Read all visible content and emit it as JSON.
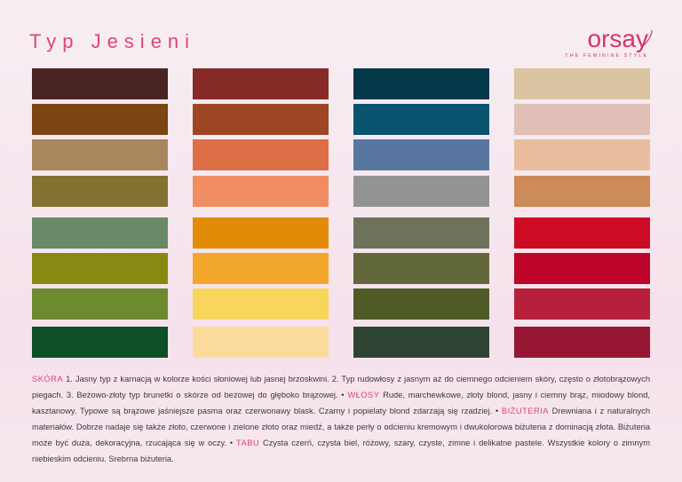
{
  "title": "Typ Jesieni",
  "brand": {
    "name": "orsay",
    "tagline": "THE FEMININE STYLE"
  },
  "palette": [
    {
      "column": 1,
      "colors": [
        "#4a2422",
        "#7a4512",
        "#a8875f",
        "#847232",
        "#688a66",
        "#878913",
        "#6e8a2f",
        "#0d4f27"
      ]
    },
    {
      "column": 2,
      "colors": [
        "#852a27",
        "#9e4623",
        "#dc6f45",
        "#f08d61",
        "#e28b07",
        "#f2a72c",
        "#f8d55b",
        "#fbdb9c"
      ]
    },
    {
      "column": 3,
      "colors": [
        "#033848",
        "#08546e",
        "#5877a0",
        "#939391",
        "#6e725a",
        "#63683a",
        "#4f5a27",
        "#2e4432"
      ]
    },
    {
      "column": 4,
      "colors": [
        "#dbc4a2",
        "#dfbfb6",
        "#e8bc9d",
        "#cc8b59",
        "#cd0b25",
        "#bd0529",
        "#b7203a",
        "#961634"
      ]
    }
  ],
  "description": {
    "skin_label": "SKÓRA",
    "skin_text": " 1. Jasny typ z karnacją w kolorze kości słoniowej lub jasnej brzoskwini. 2. Typ rudowłosy z jasnym aż do ciemnego odcieniem skóry, często o złotobrązowych piegach. 3. Beżowo-złoty typ brunetki o skórze od beżowej do głęboko brązowej. • ",
    "hair_label": "WŁOSY",
    "hair_text": " Rude, marchewkowe, złoty blond, jasny i ciemny brąz, miodowy blond, kasztanowy. Typowe są brązowe jaśniejsze pasma oraz czerwonawy blask. Czarny i popielaty blond zdarzają się rzadziej. • ",
    "jewelry_label": "BIŻUTERIA",
    "jewelry_text": " Drewniana i z naturalnych materiałów. Dobrze nadaje się także złoto, czerwone i zielone złoto oraz miedź, a także perły o odcieniu kremowym i dwukolorowa biżuteria z dominacją złota. Biżuteria może być duża, dekoracyjna, rzucająca się w oczy. • ",
    "taboo_label": "TABU",
    "taboo_text": " Czysta czerń, czysta biel, różowy, szary, czyste, zimne i delikatne pastele. Wszystkie kolory o zimnym niebieskim odcieniu. Srebrna biżuteria."
  }
}
